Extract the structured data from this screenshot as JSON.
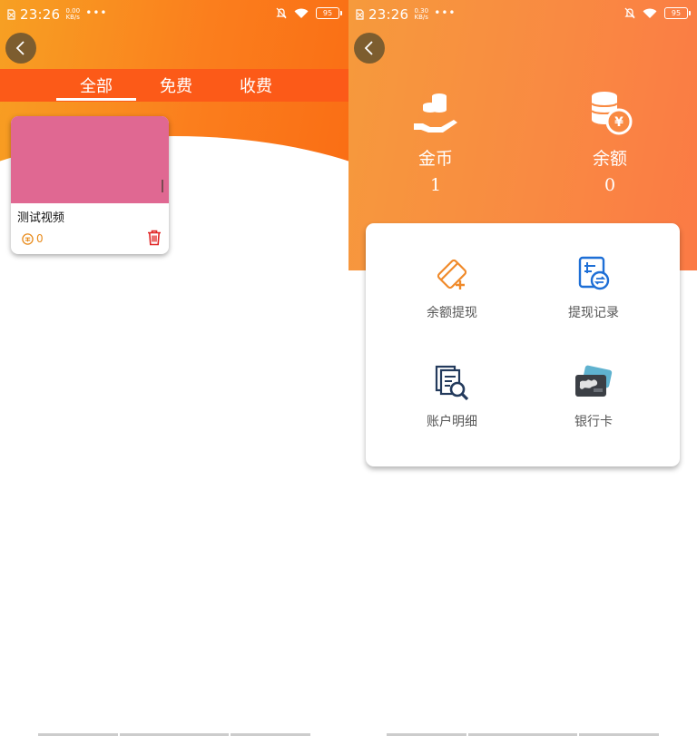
{
  "status_bar_left": {
    "time": "23:26",
    "speed_value": "0.00",
    "speed_unit": "KB/s",
    "more": "•••",
    "battery": "95"
  },
  "status_bar_right": {
    "time": "23:26",
    "speed_value": "0.30",
    "speed_unit": "KB/s",
    "more": "•••",
    "battery": "95"
  },
  "tabs": [
    {
      "label": "全部",
      "selected": true
    },
    {
      "label": "免费",
      "selected": false
    },
    {
      "label": "收费",
      "selected": false
    }
  ],
  "video": {
    "title": "测试视频",
    "count": "0",
    "thumbnail_color": "#e06892"
  },
  "wallet": {
    "coins_label": "金币",
    "coins_value": "1",
    "balance_label": "余额",
    "balance_value": "0"
  },
  "functions": [
    {
      "label": "余额提现",
      "icon": "withdraw-card-icon"
    },
    {
      "label": "提现记录",
      "icon": "withdraw-record-icon"
    },
    {
      "label": "账户明细",
      "icon": "account-detail-icon"
    },
    {
      "label": "银行卡",
      "icon": "bank-card-icon"
    }
  ],
  "colors": {
    "accent_orange": "#fc5a18",
    "icon_blue": "#1e6fd6",
    "icon_orange": "#f08a2a"
  }
}
